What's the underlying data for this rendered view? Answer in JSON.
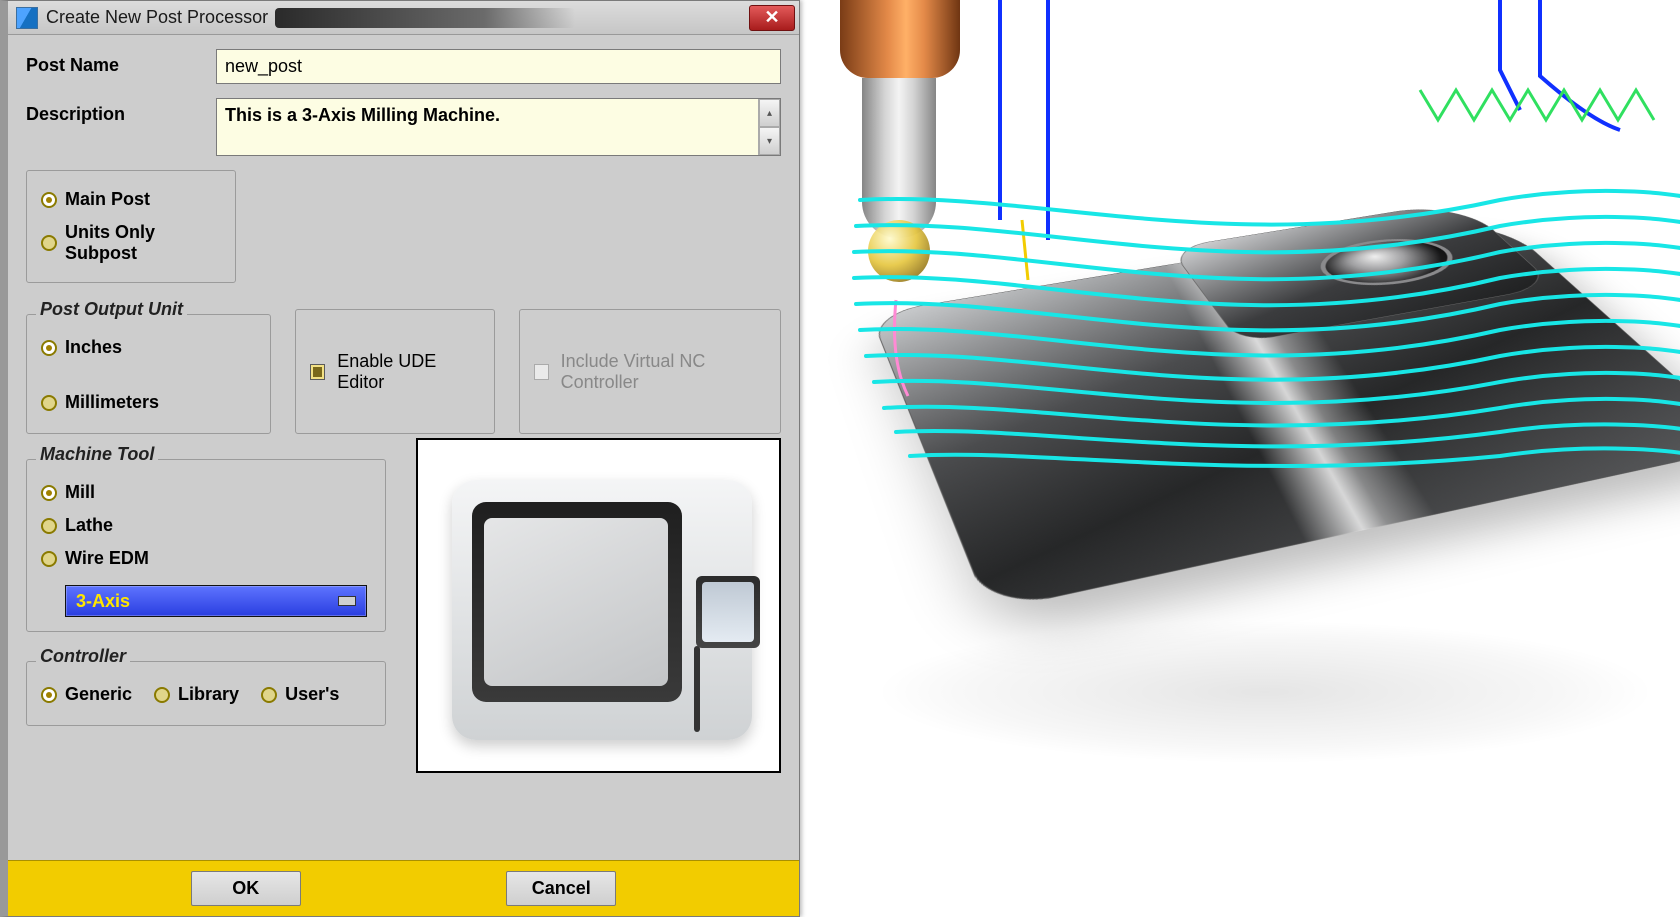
{
  "dialog": {
    "title": "Create New Post Processor",
    "close_glyph": "✕",
    "fields": {
      "post_name_label": "Post Name",
      "post_name_value": "new_post",
      "description_label": "Description",
      "description_value": "This is a 3-Axis Milling Machine."
    },
    "post_type": {
      "main_post": "Main Post",
      "units_only_subpost": "Units Only Subpost",
      "selected": "main_post"
    },
    "output_unit": {
      "caption": "Post Output Unit",
      "inches": "Inches",
      "millimeters": "Millimeters",
      "selected": "inches"
    },
    "ude": {
      "label": "Enable UDE Editor",
      "checked": true
    },
    "vnc": {
      "label": "Include Virtual NC Controller",
      "checked": false,
      "enabled": false
    },
    "machine_tool": {
      "caption": "Machine Tool",
      "mill": "Mill",
      "lathe": "Lathe",
      "wire_edm": "Wire EDM",
      "selected": "mill",
      "axis_selected": "3-Axis"
    },
    "controller": {
      "caption": "Controller",
      "generic": "Generic",
      "library": "Library",
      "users": "User's",
      "selected": "generic"
    },
    "buttons": {
      "ok": "OK",
      "cancel": "Cancel"
    }
  },
  "viewport": {
    "toolpath_color": "#18e6e6",
    "rapid_color": "#1030ff",
    "lead_color": "#30e060"
  }
}
